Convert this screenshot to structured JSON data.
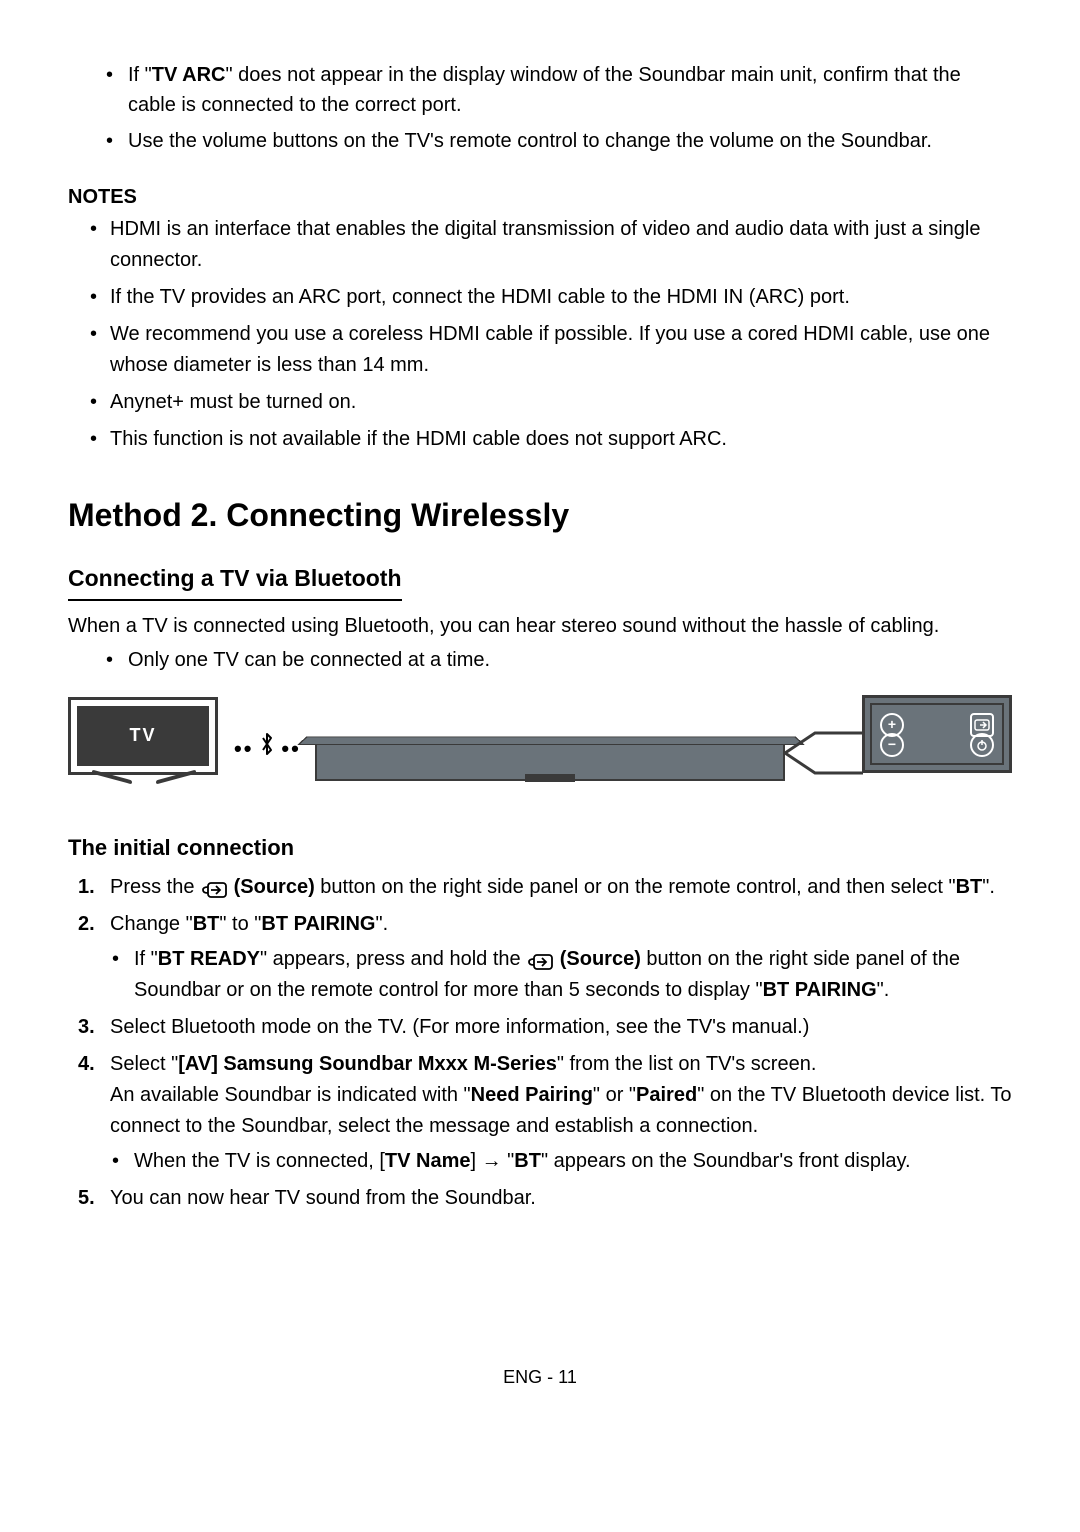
{
  "topBullets": {
    "item1_pre": "If \"",
    "item1_bold": "TV ARC",
    "item1_post": "\" does not appear in the display window of the Soundbar main unit, confirm that the cable is connected to the correct port.",
    "item2": "Use the volume buttons on the TV's remote control to change the volume on the Soundbar."
  },
  "notesHeading": "NOTES",
  "notes": {
    "n1": "HDMI is an interface that enables the digital transmission of video and audio data with just a single connector.",
    "n2": "If the TV provides an ARC port, connect the HDMI cable to the HDMI IN (ARC) port.",
    "n3": "We recommend you use a coreless HDMI cable if possible. If you use a cored HDMI cable, use one whose diameter is less than 14 mm.",
    "n4": "Anynet+ must be turned on.",
    "n5": "This function is not available if the HDMI cable does not support ARC."
  },
  "method2Heading": "Method 2. Connecting Wirelessly",
  "btHeading": "Connecting a TV via Bluetooth",
  "btBody": "When a TV is connected using Bluetooth, you can hear stereo sound without the hassle of cabling.",
  "btBullet": "Only one TV can be connected at a time.",
  "diagram": {
    "tvLabel": "TV"
  },
  "initialHeading": "The initial connection",
  "steps": {
    "s1_pre": "Press the ",
    "s1_source": " (Source)",
    "s1_mid": " button on the right side panel or on the remote control, and then select \"",
    "s1_bt": "BT",
    "s1_end": "\".",
    "s2_pre": "Change \"",
    "s2_bt": "BT",
    "s2_mid": "\" to \"",
    "s2_pair": "BT PAIRING",
    "s2_end": "\".",
    "s2sub_pre": "If \"",
    "s2sub_ready": "BT READY",
    "s2sub_mid1": "\" appears, press and hold the ",
    "s2sub_source": " (Source)",
    "s2sub_mid2": " button on the right side panel of the Soundbar or on the remote control for more than 5 seconds to display \"",
    "s2sub_pair": "BT PAIRING",
    "s2sub_end": "\".",
    "s3": "Select Bluetooth mode on the TV. (For more information, see the TV's manual.)",
    "s4_pre": "Select \"",
    "s4_av": "[AV] Samsung Soundbar Mxxx M-Series",
    "s4_mid1": "\" from the list on TV's screen.",
    "s4_line2_pre": "An available Soundbar is indicated with \"",
    "s4_need": "Need Pairing",
    "s4_or": "\" or \"",
    "s4_paired": "Paired",
    "s4_line2_end": "\" on the TV Bluetooth device list. To connect to the Soundbar, select the message and establish a connection.",
    "s4sub_pre": "When the TV is connected, [",
    "s4sub_tvname": "TV Name",
    "s4sub_mid": "] → \"",
    "s4sub_bt": "BT",
    "s4sub_end": "\" appears on the Soundbar's front display.",
    "s5": "You can now hear TV sound from the Soundbar."
  },
  "footer": "ENG - 11"
}
